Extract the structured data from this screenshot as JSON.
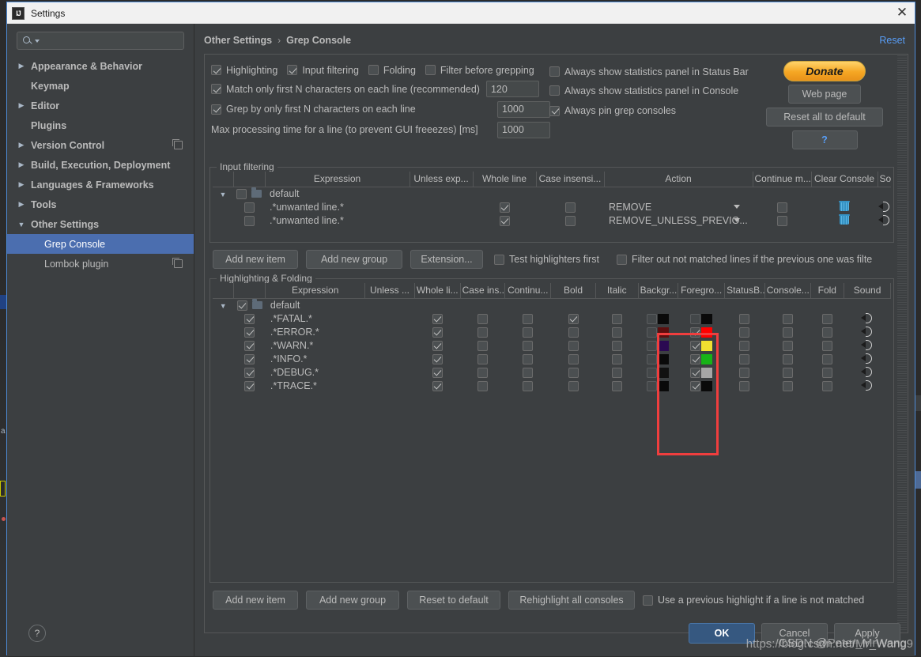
{
  "window": {
    "title": "Settings",
    "icon": "intellij-idea-icon",
    "close_label": "✕"
  },
  "sidebar": {
    "search": {
      "placeholder": "",
      "value": "",
      "icon": "search-icon"
    },
    "items": [
      {
        "label": "Appearance & Behavior",
        "twisty": "▶",
        "level": 1,
        "selected": false,
        "copy": false
      },
      {
        "label": "Keymap",
        "twisty": "",
        "level": 1,
        "selected": false,
        "copy": false
      },
      {
        "label": "Editor",
        "twisty": "▶",
        "level": 1,
        "selected": false,
        "copy": false
      },
      {
        "label": "Plugins",
        "twisty": "",
        "level": 1,
        "selected": false,
        "copy": false
      },
      {
        "label": "Version Control",
        "twisty": "▶",
        "level": 1,
        "selected": false,
        "copy": true
      },
      {
        "label": "Build, Execution, Deployment",
        "twisty": "▶",
        "level": 1,
        "selected": false,
        "copy": false
      },
      {
        "label": "Languages & Frameworks",
        "twisty": "▶",
        "level": 1,
        "selected": false,
        "copy": false
      },
      {
        "label": "Tools",
        "twisty": "▶",
        "level": 1,
        "selected": false,
        "copy": false
      },
      {
        "label": "Other Settings",
        "twisty": "▼",
        "level": 1,
        "selected": false,
        "copy": false
      },
      {
        "label": "Grep Console",
        "twisty": "",
        "level": 2,
        "selected": true,
        "copy": false
      },
      {
        "label": "Lombok plugin",
        "twisty": "",
        "level": 2,
        "selected": false,
        "copy": true
      }
    ]
  },
  "breadcrumb": {
    "parent": "Other Settings",
    "separator": "›",
    "current": "Grep Console",
    "reset_label": "Reset"
  },
  "options": {
    "row1": [
      {
        "label": "Highlighting",
        "checked": true
      },
      {
        "label": "Input filtering",
        "checked": true
      },
      {
        "label": "Folding",
        "checked": false
      },
      {
        "label": "Filter before grepping",
        "checked": false
      },
      {
        "label": "Always show statistics panel in Status Bar",
        "checked": false
      }
    ],
    "row2": {
      "label": "Match only first N characters on each line (recommended)",
      "checked": true,
      "value": "120"
    },
    "row2_right": {
      "label": "Always show statistics panel in Console",
      "checked": false
    },
    "row3": {
      "label": "Grep by only first N characters on each line",
      "checked": true,
      "value": "1000"
    },
    "row3_right": {
      "label": "Always pin grep consoles",
      "checked": true
    },
    "row4": {
      "label": "Max processing time for a line (to prevent GUI freeezes) [ms]",
      "value": "1000"
    },
    "buttons": {
      "donate": "Donate",
      "web_page": "Web page",
      "reset_all": "Reset all to default",
      "help": "?"
    }
  },
  "input_filtering": {
    "title": "Input filtering",
    "columns": [
      "",
      "",
      "Expression",
      "Unless exp...",
      "Whole line",
      "Case insensi...",
      "Action",
      "Continue m...",
      "Clear Console",
      "So"
    ],
    "group": {
      "label": "default",
      "twisty": "▼",
      "checked": false
    },
    "rows": [
      {
        "enabled": false,
        "expression": ".*unwanted line.*",
        "unless_expression": "",
        "whole_line": true,
        "case_insensitive": false,
        "action": "REMOVE",
        "continue_matching": false,
        "clear_console": "trash-icon",
        "sound": "sound-icon"
      },
      {
        "enabled": false,
        "expression": ".*unwanted line.*",
        "unless_expression": "",
        "whole_line": true,
        "case_insensitive": false,
        "action": "REMOVE_UNLESS_PREVIO...",
        "continue_matching": false,
        "clear_console": "trash-icon",
        "sound": "sound-icon"
      }
    ],
    "buttons": [
      "Add new item",
      "Add new group",
      "Extension..."
    ],
    "checkboxes": [
      {
        "label": "Test highlighters first",
        "checked": false
      },
      {
        "label": "Filter out not matched lines if the previous one was filte",
        "checked": false
      }
    ]
  },
  "highlighting": {
    "title": "Highlighting & Folding",
    "columns": [
      "",
      "",
      "Expression",
      "Unless ...",
      "Whole li...",
      "Case ins...",
      "Continu...",
      "Bold",
      "Italic",
      "Backgr...",
      "Foregro...",
      "StatusB...",
      "Console...",
      "Fold",
      "Sound"
    ],
    "group": {
      "label": "default",
      "twisty": "▼",
      "checked": true
    },
    "rows": [
      {
        "enabled": true,
        "expression": ".*FATAL.*",
        "unless": false,
        "whole_line": true,
        "case_ins": false,
        "continue": false,
        "bold": true,
        "italic": false,
        "background_checked": false,
        "background_color": "#0a0a0a",
        "foreground_checked": false,
        "foreground_color": "#0a0a0a",
        "status_bar": false,
        "console": false,
        "fold": false,
        "sound": "sound-icon"
      },
      {
        "enabled": true,
        "expression": ".*ERROR.*",
        "unless": false,
        "whole_line": true,
        "case_ins": false,
        "continue": false,
        "bold": false,
        "italic": false,
        "background_checked": false,
        "background_color": "#5c0f0f",
        "foreground_checked": true,
        "foreground_color": "#ff0000",
        "status_bar": false,
        "console": false,
        "fold": false,
        "sound": "sound-icon"
      },
      {
        "enabled": true,
        "expression": ".*WARN.*",
        "unless": false,
        "whole_line": true,
        "case_ins": false,
        "continue": false,
        "bold": false,
        "italic": false,
        "background_checked": false,
        "background_color": "#2b0a52",
        "foreground_checked": true,
        "foreground_color": "#f0e030",
        "status_bar": false,
        "console": false,
        "fold": false,
        "sound": "sound-icon"
      },
      {
        "enabled": true,
        "expression": ".*INFO.*",
        "unless": false,
        "whole_line": true,
        "case_ins": false,
        "continue": false,
        "bold": false,
        "italic": false,
        "background_checked": false,
        "background_color": "#0a0a0a",
        "foreground_checked": true,
        "foreground_color": "#17b317",
        "status_bar": false,
        "console": false,
        "fold": false,
        "sound": "sound-icon"
      },
      {
        "enabled": true,
        "expression": ".*DEBUG.*",
        "unless": false,
        "whole_line": true,
        "case_ins": false,
        "continue": false,
        "bold": false,
        "italic": false,
        "background_checked": false,
        "background_color": "#111111",
        "foreground_checked": true,
        "foreground_color": "#a6a6a6",
        "status_bar": false,
        "console": false,
        "fold": false,
        "sound": "sound-icon"
      },
      {
        "enabled": true,
        "expression": ".*TRACE.*",
        "unless": false,
        "whole_line": true,
        "case_ins": false,
        "continue": false,
        "bold": false,
        "italic": false,
        "background_checked": false,
        "background_color": "#0a0a0a",
        "foreground_checked": true,
        "foreground_color": "#0a0a0a",
        "status_bar": false,
        "console": false,
        "fold": false,
        "sound": "sound-icon"
      }
    ],
    "buttons": [
      "Add new item",
      "Add new group",
      "Reset to default",
      "Rehighlight all consoles"
    ],
    "checkbox": {
      "label": "Use a previous highlight if a line is not matched",
      "checked": false
    },
    "highlight_box_color": "#f03e3e"
  },
  "footer": {
    "help": "?",
    "ok": "OK",
    "cancel": "Cancel",
    "apply": "Apply"
  },
  "watermark": {
    "text": "https://blog.csdn.net/Mr_Wang9",
    "text2": "CSDN @Peter_MrWang"
  }
}
